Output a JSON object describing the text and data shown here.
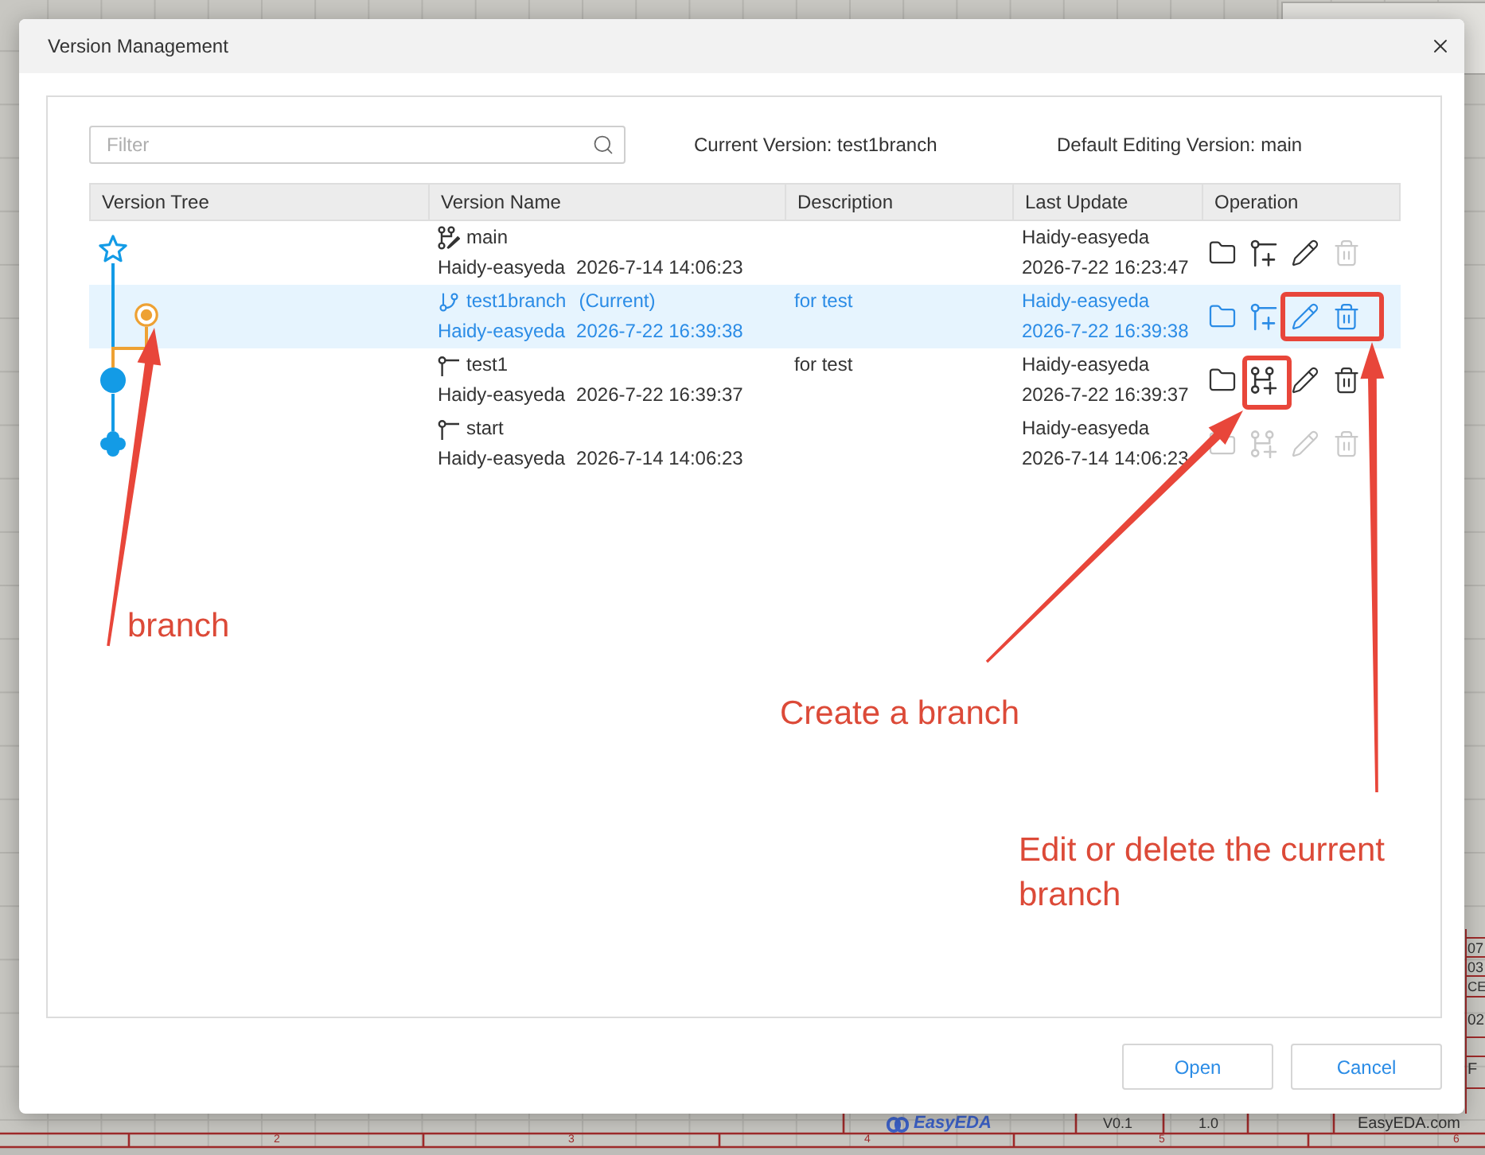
{
  "canvas": {
    "logo": "EasyEDA",
    "title_block": [
      "V0.1",
      "1.0",
      "EasyEDA.com"
    ],
    "edge_cells": [
      "07",
      "03",
      "CE",
      "02",
      "F"
    ],
    "ruler": [
      "2",
      "3",
      "4",
      "5",
      "6"
    ]
  },
  "window": {
    "title": "Version Management"
  },
  "filter": {
    "placeholder": "Filter"
  },
  "current_version": "Current Version: test1branch",
  "default_editing_version": "Default Editing Version: main",
  "table": {
    "columns": [
      "Version Tree",
      "Version Name",
      "Description",
      "Last Update",
      "Operation"
    ],
    "rows": [
      {
        "kind": "default",
        "selected": false,
        "name": "main",
        "author": "Haidy-easyeda",
        "created": "2026-7-14 14:06:23",
        "updated_by": "Haidy-easyeda",
        "updated": "2026-7-22 16:23:47",
        "operations": [
          {
            "kind": "open",
            "disabled": false
          },
          {
            "kind": "add-version",
            "disabled": false
          },
          {
            "kind": "edit",
            "disabled": false
          },
          {
            "kind": "delete",
            "disabled": true
          }
        ]
      },
      {
        "kind": "branch",
        "selected": true,
        "name": "test1branch",
        "current_label": "(Current)",
        "author": "Haidy-easyeda",
        "created": "2026-7-22 16:39:38",
        "description": "for test",
        "updated_by": "Haidy-easyeda",
        "updated": "2026-7-22 16:39:38",
        "operations": [
          {
            "kind": "open",
            "disabled": false
          },
          {
            "kind": "add-version",
            "disabled": false
          },
          {
            "kind": "edit",
            "disabled": false
          },
          {
            "kind": "delete",
            "disabled": false
          }
        ]
      },
      {
        "kind": "version",
        "selected": false,
        "name": "test1",
        "author": "Haidy-easyeda",
        "created": "2026-7-22 16:39:37",
        "description": "for test",
        "updated_by": "Haidy-easyeda",
        "updated": "2026-7-22 16:39:37",
        "operations": [
          {
            "kind": "open",
            "disabled": false
          },
          {
            "kind": "add-branch",
            "disabled": false
          },
          {
            "kind": "edit",
            "disabled": false
          },
          {
            "kind": "delete",
            "disabled": false
          }
        ]
      },
      {
        "kind": "root",
        "selected": false,
        "name": "start",
        "author": "Haidy-easyeda",
        "created": "2026-7-14 14:06:23",
        "updated_by": "Haidy-easyeda",
        "updated": "2026-7-14 14:06:23",
        "operations": [
          {
            "kind": "open",
            "disabled": true
          },
          {
            "kind": "add-branch",
            "disabled": true
          },
          {
            "kind": "edit",
            "disabled": true
          },
          {
            "kind": "delete",
            "disabled": true
          }
        ]
      }
    ]
  },
  "buttons": [
    {
      "label": "Open"
    },
    {
      "label": "Cancel"
    }
  ],
  "annotations": [
    {
      "text": "branch"
    },
    {
      "text": "Create a branch"
    },
    {
      "text": "Edit or delete the current branch"
    }
  ]
}
